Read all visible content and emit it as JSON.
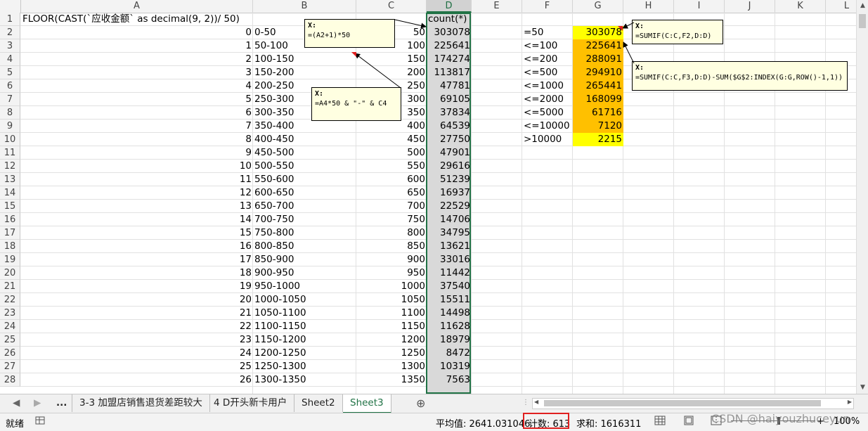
{
  "columns": [
    "A",
    "B",
    "C",
    "D",
    "E",
    "F",
    "G",
    "H",
    "I",
    "J",
    "K",
    "L"
  ],
  "row_numbers": [
    1,
    2,
    3,
    4,
    5,
    6,
    7,
    8,
    9,
    10,
    11,
    12,
    13,
    14,
    15,
    16,
    17,
    18,
    19,
    20,
    21,
    22,
    23,
    24,
    25,
    26,
    27,
    28
  ],
  "header_row": {
    "A": "FLOOR(CAST(`应收金额` as decimal(9, 2))/ 50)",
    "D": "count(*)"
  },
  "data_rows": [
    {
      "a": "0",
      "b": "0-50",
      "c": "50",
      "d": "303078"
    },
    {
      "a": "1",
      "b": "50-100",
      "c": "100",
      "d": "225641"
    },
    {
      "a": "2",
      "b": "100-150",
      "c": "150",
      "d": "174274"
    },
    {
      "a": "3",
      "b": "150-200",
      "c": "200",
      "d": "113817"
    },
    {
      "a": "4",
      "b": "200-250",
      "c": "250",
      "d": "47781"
    },
    {
      "a": "5",
      "b": "250-300",
      "c": "300",
      "d": "69105"
    },
    {
      "a": "6",
      "b": "300-350",
      "c": "350",
      "d": "37834"
    },
    {
      "a": "7",
      "b": "350-400",
      "c": "400",
      "d": "64539"
    },
    {
      "a": "8",
      "b": "400-450",
      "c": "450",
      "d": "27750"
    },
    {
      "a": "9",
      "b": "450-500",
      "c": "500",
      "d": "47901"
    },
    {
      "a": "10",
      "b": "500-550",
      "c": "550",
      "d": "29616"
    },
    {
      "a": "11",
      "b": "550-600",
      "c": "600",
      "d": "51239"
    },
    {
      "a": "12",
      "b": "600-650",
      "c": "650",
      "d": "16937"
    },
    {
      "a": "13",
      "b": "650-700",
      "c": "700",
      "d": "22529"
    },
    {
      "a": "14",
      "b": "700-750",
      "c": "750",
      "d": "14706"
    },
    {
      "a": "15",
      "b": "750-800",
      "c": "800",
      "d": "34795"
    },
    {
      "a": "16",
      "b": "800-850",
      "c": "850",
      "d": "13621"
    },
    {
      "a": "17",
      "b": "850-900",
      "c": "900",
      "d": "33016"
    },
    {
      "a": "18",
      "b": "900-950",
      "c": "950",
      "d": "11442"
    },
    {
      "a": "19",
      "b": "950-1000",
      "c": "1000",
      "d": "37540"
    },
    {
      "a": "20",
      "b": "1000-1050",
      "c": "1050",
      "d": "15511"
    },
    {
      "a": "21",
      "b": "1050-1100",
      "c": "1100",
      "d": "14498"
    },
    {
      "a": "22",
      "b": "1100-1150",
      "c": "1150",
      "d": "11628"
    },
    {
      "a": "23",
      "b": "1150-1200",
      "c": "1200",
      "d": "18979"
    },
    {
      "a": "24",
      "b": "1200-1250",
      "c": "1250",
      "d": "8472"
    },
    {
      "a": "25",
      "b": "1250-1300",
      "c": "1300",
      "d": "10319"
    },
    {
      "a": "26",
      "b": "1300-1350",
      "c": "1350",
      "d": "7563"
    }
  ],
  "summary": [
    {
      "f": "=50",
      "g": "303078",
      "color": "yellow"
    },
    {
      "f": "<=100",
      "g": "225641",
      "color": "orange"
    },
    {
      "f": "<=200",
      "g": "288091",
      "color": "orange"
    },
    {
      "f": "<=500",
      "g": "294910",
      "color": "orange"
    },
    {
      "f": "<=1000",
      "g": "265441",
      "color": "orange"
    },
    {
      "f": "<=2000",
      "g": "168099",
      "color": "orange"
    },
    {
      "f": "<=5000",
      "g": "61716",
      "color": "orange"
    },
    {
      "f": "<=10000",
      "g": "7120",
      "color": "orange"
    },
    {
      "f": ">10000",
      "g": "2215",
      "color": "yellow"
    }
  ],
  "comments": {
    "c1": {
      "author": "X:",
      "text": "=(A2+1)*50"
    },
    "c2": {
      "author": "X:",
      "text": "=A4*50 & \"-\" & C4"
    },
    "c3": {
      "author": "X:",
      "text": "=SUMIF(C:C,F2,D:D)"
    },
    "c4": {
      "author": "X:",
      "text": "=SUMIF(C:C,F3,D:D)-SUM($G$2:INDEX(G:G,ROW()-1,1))"
    }
  },
  "tabs": {
    "ellipsis": "...",
    "items": [
      "3-3 加盟店销售退货差距较大",
      "4 D开头新卡用户",
      "Sheet2",
      "Sheet3"
    ],
    "active": "Sheet3"
  },
  "status": {
    "ready": "就绪",
    "average": "平均值: 2641.031046",
    "count": "计数: 613",
    "sum": "求和: 1616311",
    "zoom": "100%"
  },
  "watermark": "CSDN @haiyouzhuceyun",
  "colors": {
    "yellow": "#ffff00",
    "orange": "#ffc000",
    "accent": "#217346",
    "highlight_box": "#e02020"
  }
}
